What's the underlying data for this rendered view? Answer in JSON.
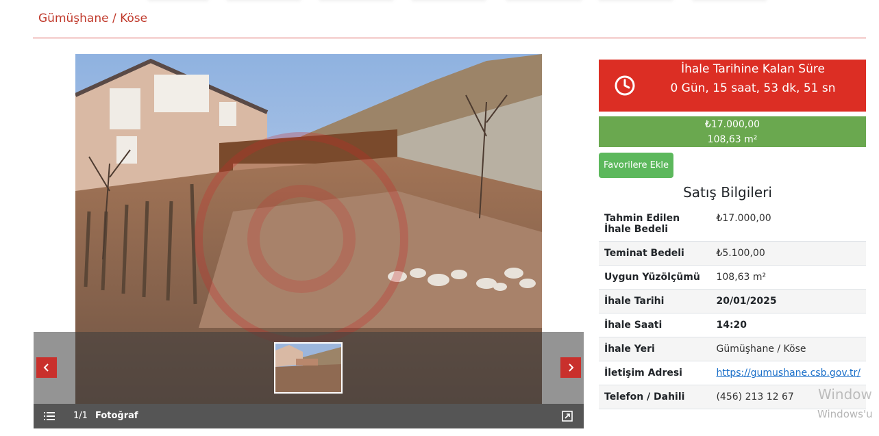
{
  "header": {
    "location_title": "Gümüşhane / Köse"
  },
  "gallery": {
    "counter": "1/1",
    "label": "Fotoğraf",
    "prev_icon": "chevron-left-icon",
    "next_icon": "chevron-right-icon",
    "list_icon": "list-icon",
    "expand_icon": "fullscreen-icon"
  },
  "countdown": {
    "title": "İhale Tarihine Kalan Süre",
    "value": "0 Gün, 15 saat, 53 dk, 51 sn",
    "icon": "clock-icon",
    "color": "#dc2e24"
  },
  "price_box": {
    "price": "₺17.000,00",
    "area": "108,63 m²",
    "color": "#6aa84f"
  },
  "favorites_button": "Favorilere Ekle",
  "sales": {
    "title": "Satış Bilgileri",
    "rows": [
      {
        "key": "Tahmin Edilen İhale Bedeli",
        "value": "₺17.000,00"
      },
      {
        "key": "Teminat Bedeli",
        "value": "₺5.100,00"
      },
      {
        "key": "Uygun Yüzölçümü",
        "value": "108,63 m²"
      },
      {
        "key": "İhale Tarihi",
        "value": "20/01/2025"
      },
      {
        "key": "İhale Saati",
        "value": "14:20"
      },
      {
        "key": "İhale Yeri",
        "value": "Gümüşhane / Köse"
      },
      {
        "key": "İletişim Adresi",
        "value": "https://gumushane.csb.gov.tr/"
      },
      {
        "key": "Telefon / Dahili",
        "value": "(456) 213 12 67"
      }
    ]
  },
  "watermark": {
    "line1": "Window",
    "line2": "Windows'u"
  },
  "brand_red": "#c0392b"
}
